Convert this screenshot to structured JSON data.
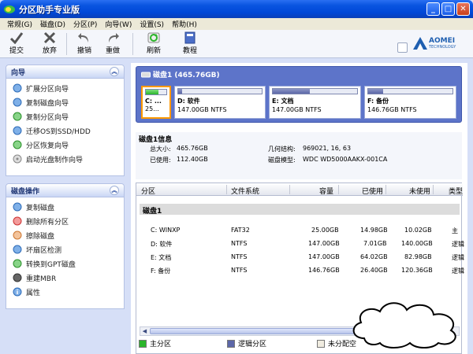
{
  "window": {
    "title": "分区助手专业版",
    "btn_min": "_",
    "btn_max": "□",
    "btn_close": "✕"
  },
  "menu": [
    "常规(G)",
    "磁盘(D)",
    "分区(P)",
    "向导(W)",
    "设置(S)",
    "帮助(H)"
  ],
  "toolbar": {
    "apply": "提交",
    "discard": "放弃",
    "undo": "撤销",
    "redo": "重做",
    "refresh": "刷新",
    "tutorial": "教程"
  },
  "logo": {
    "name": "AOMEI",
    "sub": "TECHNOLOGY"
  },
  "wizard_panel": {
    "title": "向导",
    "items": [
      "扩展分区向导",
      "复制磁盘向导",
      "复制分区向导",
      "迁移OS到SSD/HDD",
      "分区恢复向导",
      "启动光盘制作向导"
    ]
  },
  "disk_ops_panel": {
    "title": "磁盘操作",
    "items": [
      "复制磁盘",
      "删除所有分区",
      "擦除磁盘",
      "坏扇区检测",
      "转换到GPT磁盘",
      "重建MBR",
      "属性"
    ]
  },
  "disk_map": {
    "label": "磁盘1 (465.76GB)",
    "partitions": [
      {
        "name": "C: ...",
        "size": "25...",
        "used_pct": 60
      },
      {
        "name": "D: 软件",
        "size": "147.00GB NTFS",
        "used_pct": 5
      },
      {
        "name": "E: 文档",
        "size": "147.00GB NTFS",
        "used_pct": 44
      },
      {
        "name": "F: 备份",
        "size": "146.76GB NTFS",
        "used_pct": 18
      }
    ]
  },
  "disk_info": {
    "title": "磁盘1信息",
    "total_label": "总大小:",
    "total": "465.76GB",
    "used_label": "已使用:",
    "used": "112.40GB",
    "geom_label": "几何结构:",
    "geom": "969021, 16, 63",
    "model_label": "磁盘模型:",
    "model": "WDC WD5000AAKX-001CA"
  },
  "table": {
    "headers": [
      "分区",
      "文件系统",
      "容量",
      "已使用",
      "未使用",
      "类型"
    ],
    "group": "磁盘1",
    "rows": [
      [
        "C: WINXP",
        "FAT32",
        "25.00GB",
        "14.98GB",
        "10.02GB",
        "主"
      ],
      [
        "D: 软件",
        "NTFS",
        "147.00GB",
        "7.01GB",
        "140.00GB",
        "逻辑"
      ],
      [
        "E: 文档",
        "NTFS",
        "147.00GB",
        "64.02GB",
        "82.98GB",
        "逻辑"
      ],
      [
        "F: 备份",
        "NTFS",
        "146.76GB",
        "26.40GB",
        "120.36GB",
        "逻辑"
      ]
    ]
  },
  "legend": {
    "primary": "主分区",
    "logical": "逻辑分区",
    "unallocated": "未分配空"
  },
  "colors": {
    "primary": "#2bb52b",
    "logical": "#5c67a8",
    "unallocated": "#f0ece0",
    "selected_border": "#ff9900"
  }
}
